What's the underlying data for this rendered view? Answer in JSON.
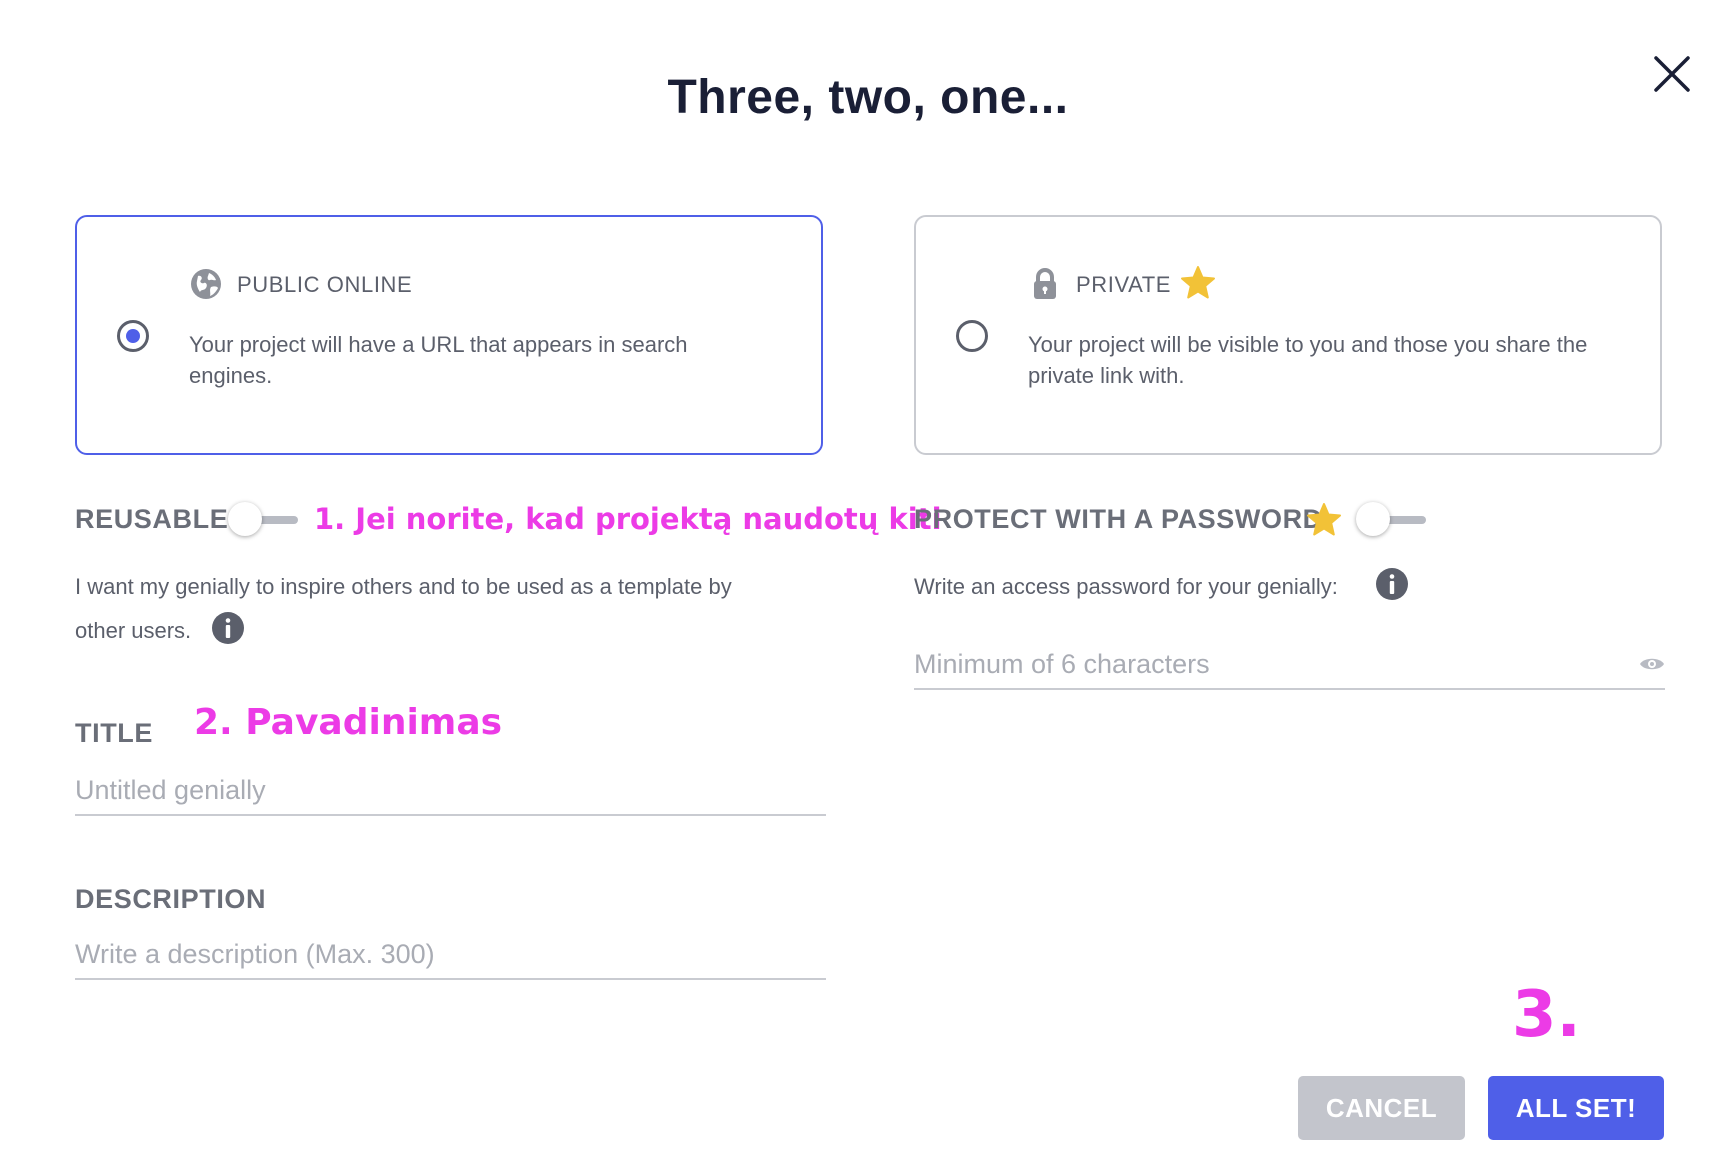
{
  "dialog": {
    "title": "Three, two, one..."
  },
  "visibility": {
    "public": {
      "label": "PUBLIC ONLINE",
      "description": "Your project will have a URL that appears in search engines.",
      "selected": true,
      "icon": "globe-icon"
    },
    "private": {
      "label": "PRIVATE",
      "description": "Your project will be visible to you and those you share the private link with.",
      "selected": false,
      "icon": "lock-icon",
      "premium_icon": "star-icon"
    }
  },
  "reusable": {
    "label": "REUSABLE",
    "enabled": false,
    "description_line1": "I want my genially to inspire others and to be used as a template by",
    "description_line2": "other users."
  },
  "password": {
    "label": "PROTECT WITH A PASSWORD",
    "enabled": false,
    "description": "Write an access password for your genially:",
    "placeholder": "Minimum of 6 characters"
  },
  "title_field": {
    "label": "TITLE",
    "placeholder": "Untitled genially"
  },
  "description_field": {
    "label": "DESCRIPTION",
    "placeholder": "Write a description (Max. 300)"
  },
  "annotations": {
    "step1": "1. Jei norite, kad projektą naudotų kiti",
    "step2": "2. Pavadinimas",
    "step3": "3."
  },
  "buttons": {
    "cancel": "CANCEL",
    "confirm": "ALL SET!"
  },
  "colors": {
    "accent": "#4f5fe8",
    "annotation": "#ec3be6",
    "star": "#f2c237",
    "cancel_bg": "#c3c5cc",
    "title_text": "#1a1f36"
  }
}
